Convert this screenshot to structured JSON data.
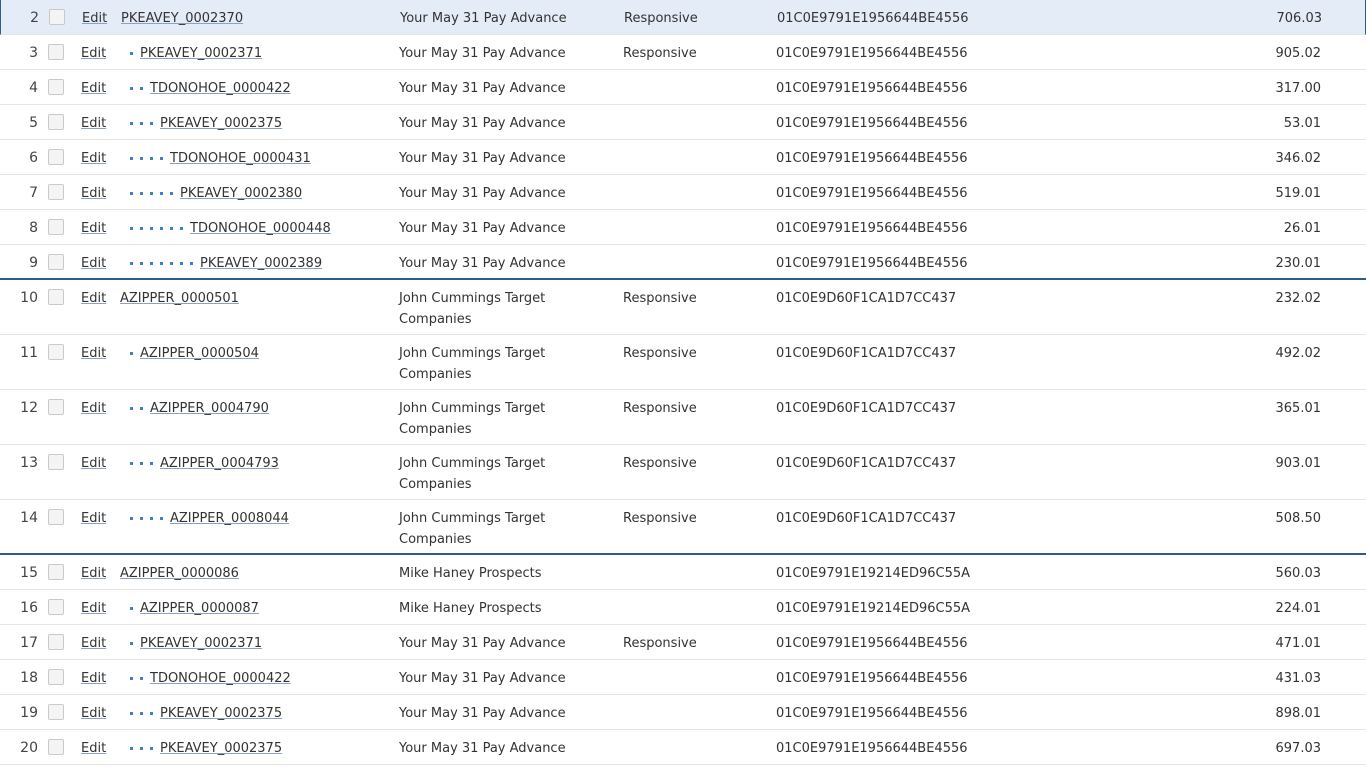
{
  "rows": [
    {
      "num": "2",
      "edit": "Edit",
      "control": "PKEAVEY_0002370",
      "indent": 0,
      "subject": "Your May 31 Pay Advance",
      "status": "Responsive",
      "hash": "01C0E9791E1956644BE4556",
      "amount": "706.03",
      "selected": true
    },
    {
      "num": "3",
      "edit": "Edit",
      "control": "PKEAVEY_0002371",
      "indent": 1,
      "subject": "Your May 31 Pay Advance",
      "status": "Responsive",
      "hash": "01C0E9791E1956644BE4556",
      "amount": "905.02"
    },
    {
      "num": "4",
      "edit": "Edit",
      "control": "TDONOHOE_0000422",
      "indent": 2,
      "subject": "Your May 31 Pay Advance",
      "status": "",
      "hash": "01C0E9791E1956644BE4556",
      "amount": "317.00"
    },
    {
      "num": "5",
      "edit": "Edit",
      "control": "PKEAVEY_0002375",
      "indent": 3,
      "subject": "Your May 31 Pay Advance",
      "status": "",
      "hash": "01C0E9791E1956644BE4556",
      "amount": "53.01"
    },
    {
      "num": "6",
      "edit": "Edit",
      "control": "TDONOHOE_0000431",
      "indent": 4,
      "subject": "Your May 31 Pay Advance",
      "status": "",
      "hash": "01C0E9791E1956644BE4556",
      "amount": "346.02"
    },
    {
      "num": "7",
      "edit": "Edit",
      "control": "PKEAVEY_0002380",
      "indent": 5,
      "subject": "Your May 31 Pay Advance",
      "status": "",
      "hash": "01C0E9791E1956644BE4556",
      "amount": "519.01"
    },
    {
      "num": "8",
      "edit": "Edit",
      "control": "TDONOHOE_0000448",
      "indent": 6,
      "subject": "Your May 31 Pay Advance",
      "status": "",
      "hash": "01C0E9791E1956644BE4556",
      "amount": "26.01"
    },
    {
      "num": "9",
      "edit": "Edit",
      "control": "PKEAVEY_0002389",
      "indent": 7,
      "subject": "Your May 31 Pay Advance",
      "status": "",
      "hash": "01C0E9791E1956644BE4556",
      "amount": "230.01",
      "groupEnd": true
    },
    {
      "num": "10",
      "edit": "Edit",
      "control": "AZIPPER_0000501",
      "indent": 0,
      "subject": "John Cummings Target Companies",
      "status": "Responsive",
      "hash": "01C0E9D60F1CA1D7CC437",
      "amount": "232.02",
      "tall": true
    },
    {
      "num": "11",
      "edit": "Edit",
      "control": "AZIPPER_0000504",
      "indent": 1,
      "subject": "John Cummings Target Companies",
      "status": "Responsive",
      "hash": "01C0E9D60F1CA1D7CC437",
      "amount": "492.02",
      "tall": true
    },
    {
      "num": "12",
      "edit": "Edit",
      "control": "AZIPPER_0004790",
      "indent": 2,
      "subject": "John Cummings Target Companies",
      "status": "Responsive",
      "hash": "01C0E9D60F1CA1D7CC437",
      "amount": "365.01",
      "tall": true
    },
    {
      "num": "13",
      "edit": "Edit",
      "control": "AZIPPER_0004793",
      "indent": 3,
      "subject": "John Cummings Target Companies",
      "status": "Responsive",
      "hash": "01C0E9D60F1CA1D7CC437",
      "amount": "903.01",
      "tall": true
    },
    {
      "num": "14",
      "edit": "Edit",
      "control": "AZIPPER_0008044",
      "indent": 4,
      "subject": "John Cummings Target Companies",
      "status": "Responsive",
      "hash": "01C0E9D60F1CA1D7CC437",
      "amount": "508.50",
      "tall": true,
      "groupEnd": true
    },
    {
      "num": "15",
      "edit": "Edit",
      "control": "AZIPPER_0000086",
      "indent": 0,
      "subject": "Mike Haney Prospects",
      "status": "",
      "hash": "01C0E9791E19214ED96C55A",
      "amount": "560.03"
    },
    {
      "num": "16",
      "edit": "Edit",
      "control": "AZIPPER_0000087",
      "indent": 1,
      "subject": "Mike Haney Prospects",
      "status": "",
      "hash": "01C0E9791E19214ED96C55A",
      "amount": "224.01"
    },
    {
      "num": "17",
      "edit": "Edit",
      "control": "PKEAVEY_0002371",
      "indent": 1,
      "subject": "Your May 31 Pay Advance",
      "status": "Responsive",
      "hash": "01C0E9791E1956644BE4556",
      "amount": "471.01"
    },
    {
      "num": "18",
      "edit": "Edit",
      "control": "TDONOHOE_0000422",
      "indent": 2,
      "subject": "Your May 31 Pay Advance",
      "status": "",
      "hash": "01C0E9791E1956644BE4556",
      "amount": "431.03"
    },
    {
      "num": "19",
      "edit": "Edit",
      "control": "PKEAVEY_0002375",
      "indent": 3,
      "subject": "Your May 31 Pay Advance",
      "status": "",
      "hash": "01C0E9791E1956644BE4556",
      "amount": "898.01"
    },
    {
      "num": "20",
      "edit": "Edit",
      "control": "PKEAVEY_0002375",
      "indent": 3,
      "subject": "Your May 31 Pay Advance",
      "status": "",
      "hash": "01C0E9791E1956644BE4556",
      "amount": "697.03"
    }
  ]
}
